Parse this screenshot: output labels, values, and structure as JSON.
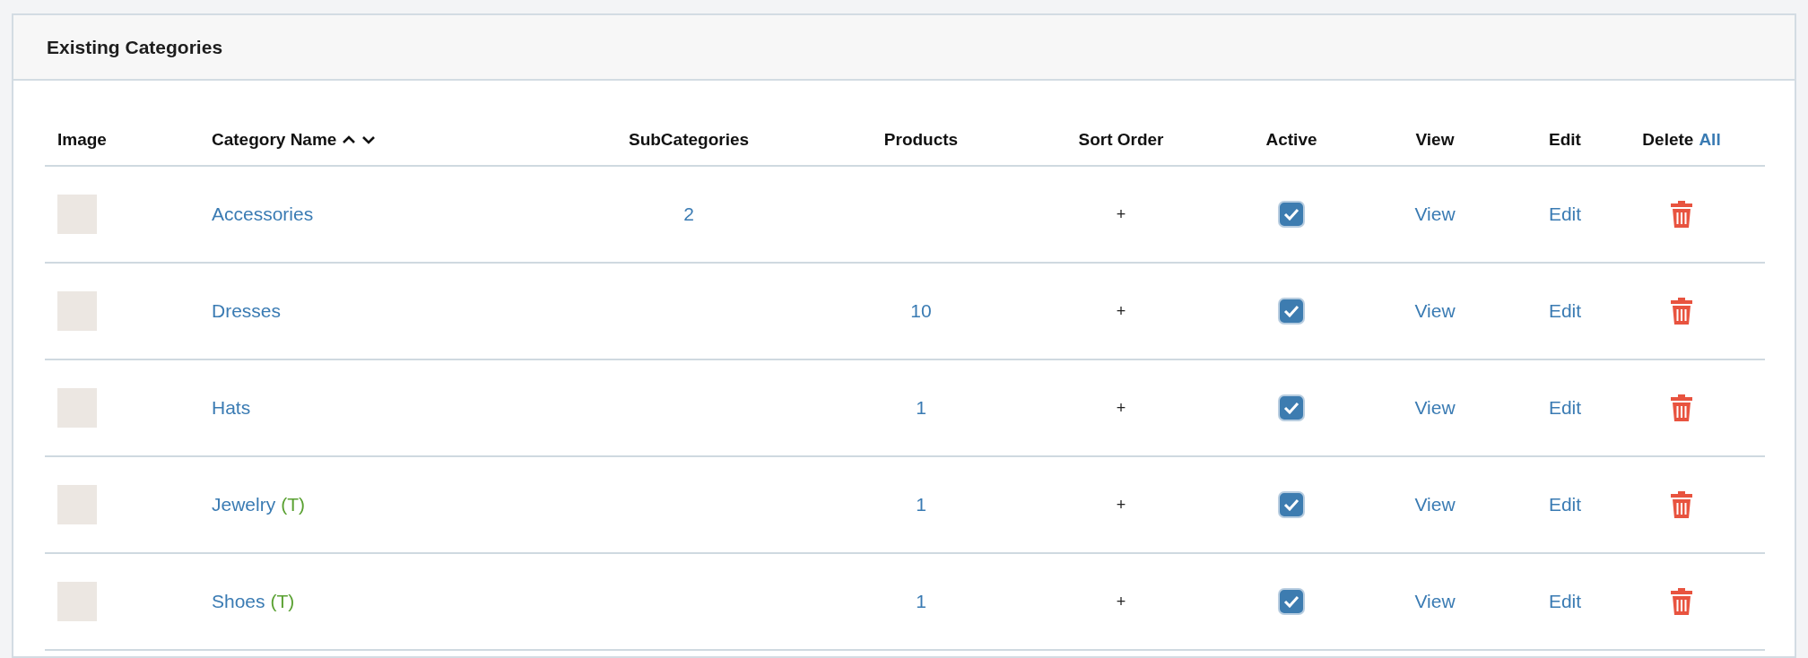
{
  "panel": {
    "title": "Existing Categories"
  },
  "table": {
    "columns": [
      {
        "kind": "plain",
        "label": "Image"
      },
      {
        "kind": "sortable",
        "label": "Category Name"
      },
      {
        "kind": "plain",
        "label": "SubCategories"
      },
      {
        "kind": "plain",
        "label": "Products"
      },
      {
        "kind": "plain",
        "label": "Sort Order"
      },
      {
        "kind": "plain",
        "label": "Active"
      },
      {
        "kind": "plain",
        "label": "View"
      },
      {
        "kind": "plain",
        "label": "Edit"
      },
      {
        "kind": "delete",
        "label": "Delete",
        "link": "All"
      }
    ],
    "rows": [
      {
        "name": "Accessories",
        "subcategories": "2",
        "sort_order": "+",
        "active": true,
        "view": "View",
        "edit": "Edit"
      },
      {
        "name": "Dresses",
        "products": "10",
        "sort_order": "+",
        "active": true,
        "view": "View",
        "edit": "Edit"
      },
      {
        "name": "Hats",
        "products": "1",
        "sort_order": "+",
        "active": true,
        "view": "View",
        "edit": "Edit"
      },
      {
        "name": "Jewelry",
        "tag": "(T)",
        "products": "1",
        "sort_order": "+",
        "active": true,
        "view": "View",
        "edit": "Edit"
      },
      {
        "name": "Shoes",
        "tag": "(T)",
        "products": "1",
        "sort_order": "+",
        "active": true,
        "view": "View",
        "edit": "Edit"
      }
    ]
  }
}
